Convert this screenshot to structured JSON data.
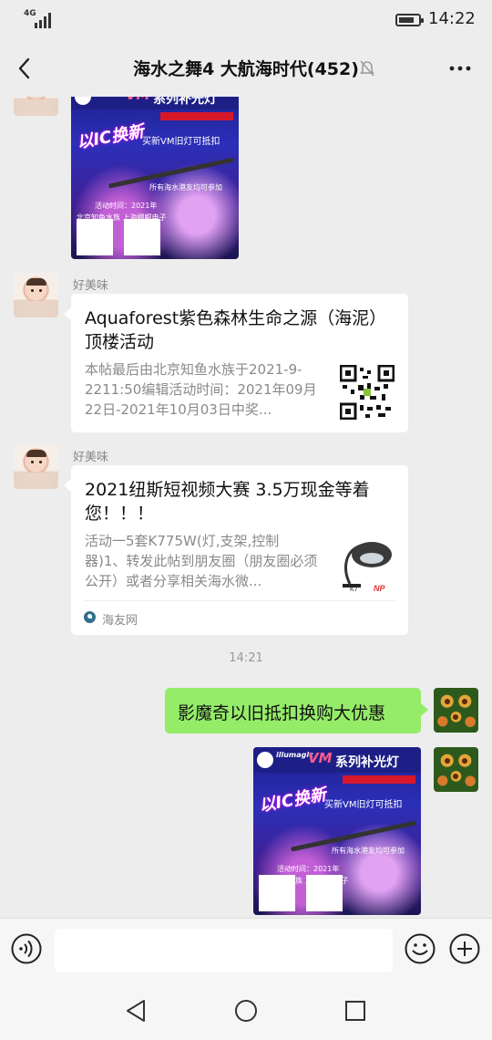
{
  "status_bar": {
    "network": "4G",
    "time": "14:22",
    "battery_level": 0.8
  },
  "header": {
    "title": "海水之舞4 大航海时代(452)",
    "back_icon": "back-arrow-icon",
    "mute_icon": "bell-muted-icon",
    "more_icon": "more-dots-icon"
  },
  "poster": {
    "brand": "illumagic",
    "vm": "VM",
    "series": "系列补光灯",
    "swap": "以IC换新",
    "line1": "买新VM旧灯可抵扣",
    "line2": "所有海水港友均可参加",
    "line3": "活动时间：2021年",
    "line4": "北京知鱼水族  上海娜鲲电子"
  },
  "messages": [
    {
      "sender": "好美味",
      "title": "Aquaforest紫色森林生命之源（海泥）顶楼活动",
      "desc": "本帖最后由北京知鱼水族于2021-9-2211:50编辑活动时间：2021年09月22日-2021年10月03日中奖..."
    },
    {
      "sender": "好美味",
      "title": "2021纽斯短视频大赛 3.5万现金等着您！！！",
      "desc": "活动一5套K775W(灯,支架,控制器)1、转发此帖到朋友圈（朋友圈必须公开）或者分享相关海水微...",
      "source": "海友网",
      "thumb_label": "K7"
    }
  ],
  "timestamp": "14:21",
  "my_message": "影魔奇以旧抵扣换购大优惠",
  "input_bar": {
    "voice_icon": "voice-icon",
    "emoji_icon": "emoji-icon",
    "plus_icon": "plus-icon",
    "text": ""
  },
  "nav_bar": [
    "back-triangle-icon",
    "home-circle-icon",
    "recents-square-icon"
  ]
}
